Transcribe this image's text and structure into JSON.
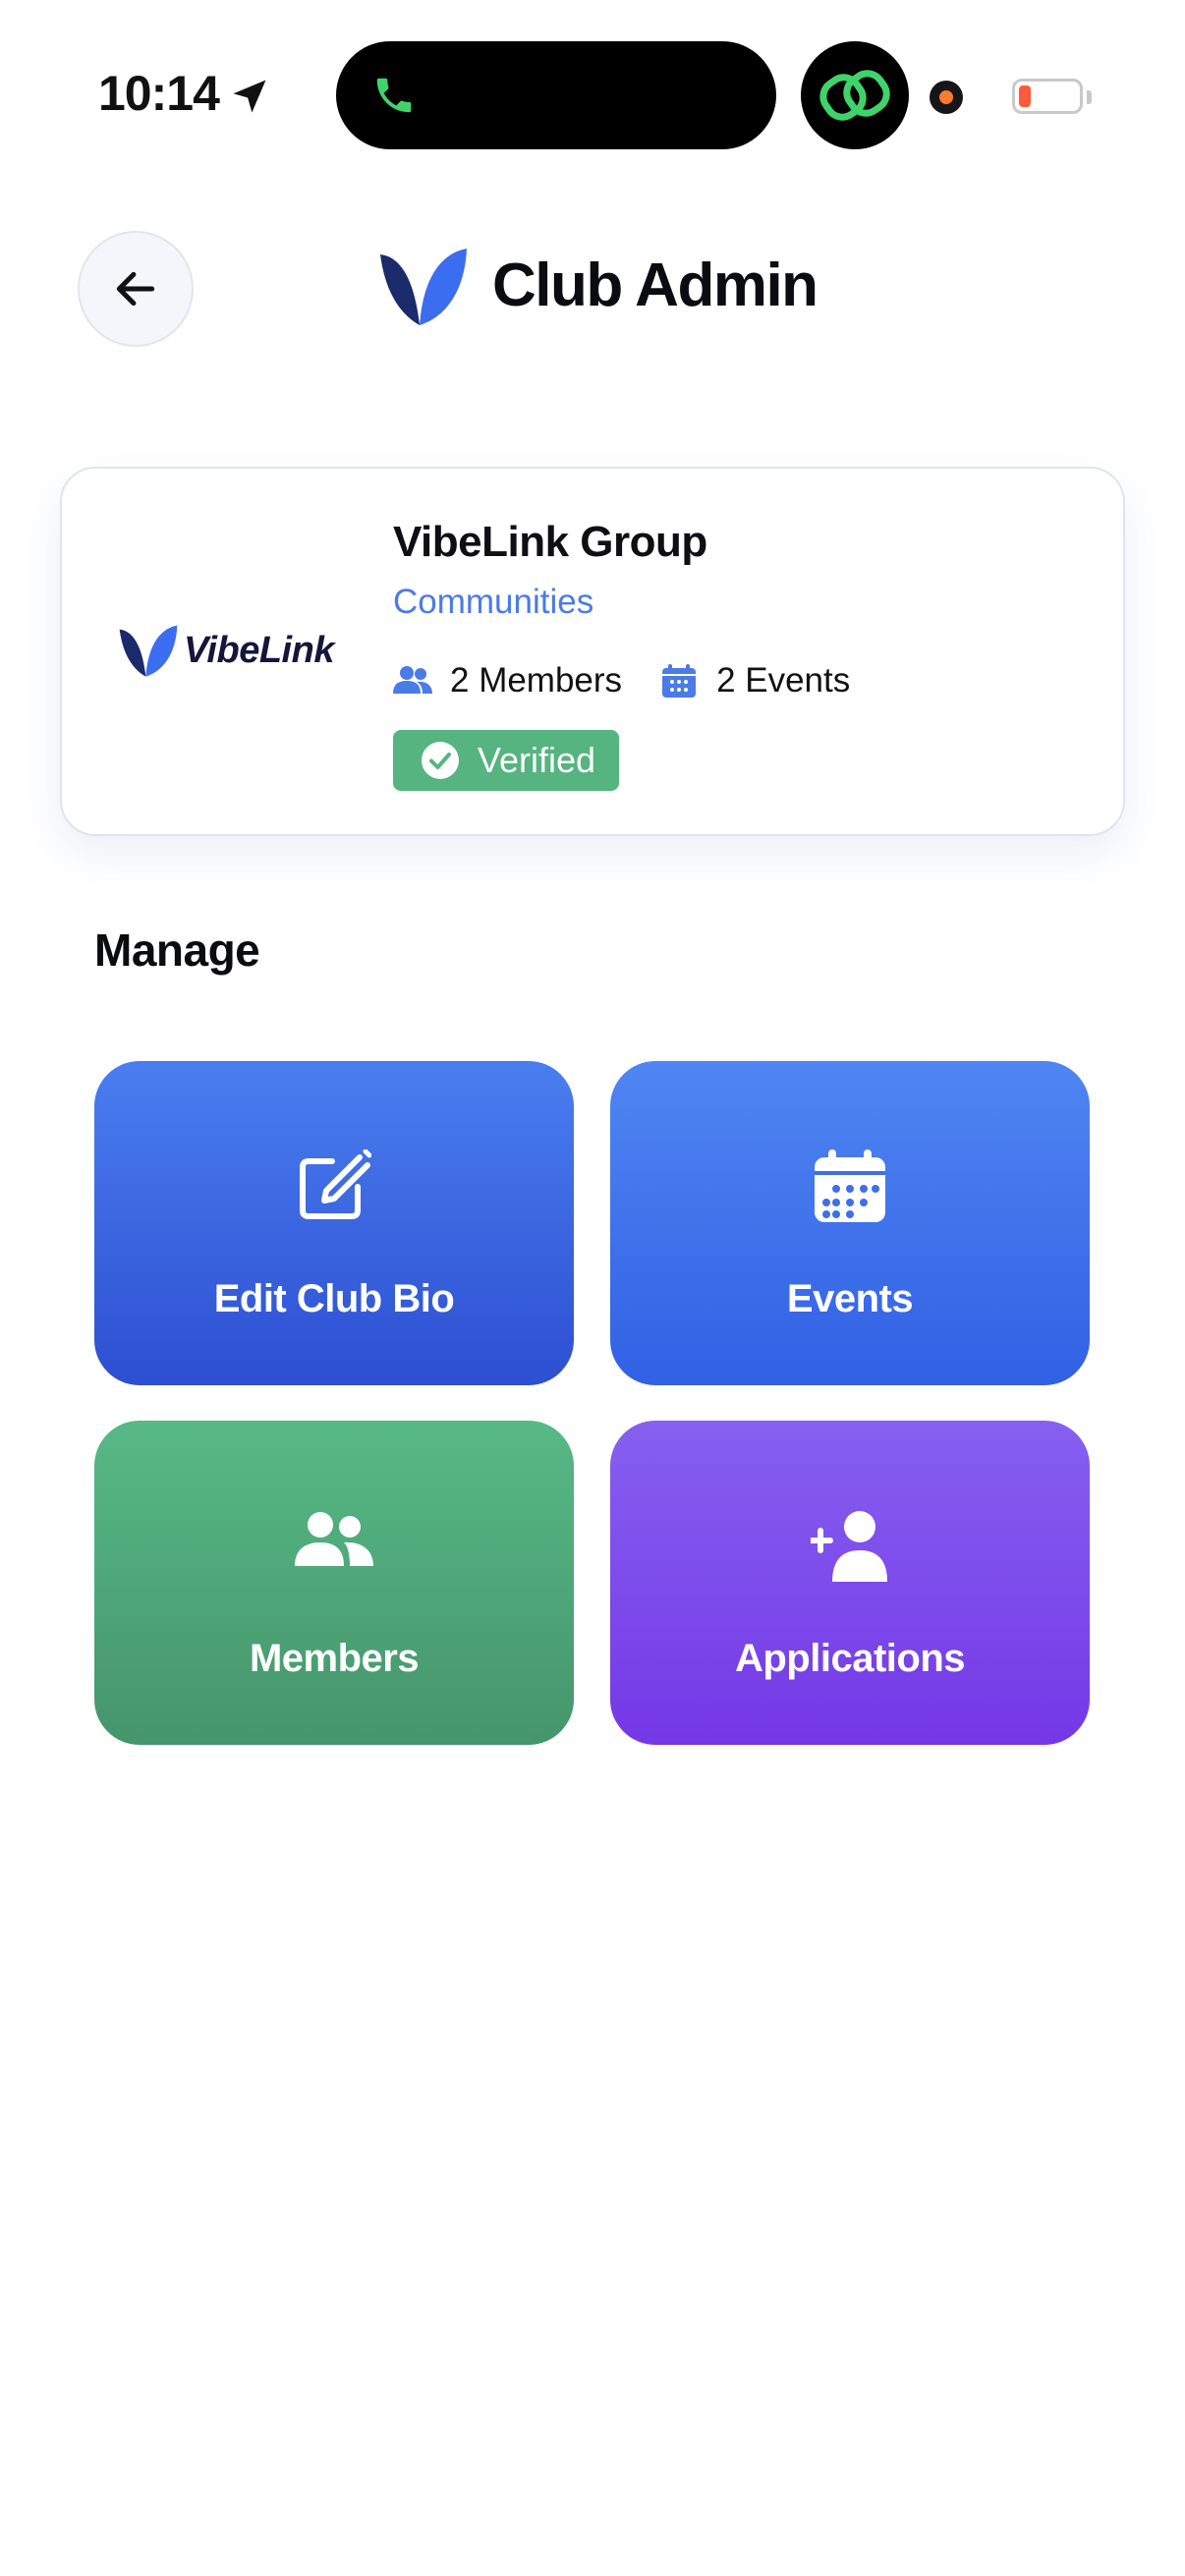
{
  "status_bar": {
    "time": "10:14"
  },
  "header": {
    "title": "Club Admin",
    "back_icon": "arrow-left-icon"
  },
  "club": {
    "logo_text": "VibeLink",
    "name": "VibeLink Group",
    "category": "Communities",
    "members_text": "2 Members",
    "events_text": "2 Events",
    "verified_label": "Verified"
  },
  "manage": {
    "title": "Manage",
    "tiles": [
      {
        "label": "Edit Club Bio",
        "icon": "edit-icon",
        "color": "#3a63e0"
      },
      {
        "label": "Events",
        "icon": "calendar-icon",
        "color": "#3d6fe9"
      },
      {
        "label": "Members",
        "icon": "people-icon",
        "color": "#4fa877"
      },
      {
        "label": "Applications",
        "icon": "add-user-icon",
        "color": "#7c4aea"
      }
    ]
  },
  "colors": {
    "accent_blue": "#4b7be6",
    "verified_green": "#55b47f"
  }
}
